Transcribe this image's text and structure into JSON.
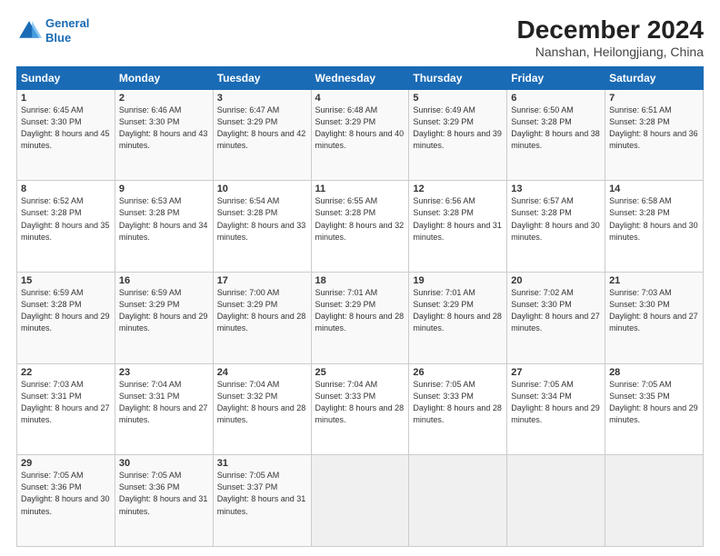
{
  "logo": {
    "line1": "General",
    "line2": "Blue"
  },
  "title": "December 2024",
  "subtitle": "Nanshan, Heilongjiang, China",
  "days_of_week": [
    "Sunday",
    "Monday",
    "Tuesday",
    "Wednesday",
    "Thursday",
    "Friday",
    "Saturday"
  ],
  "weeks": [
    [
      {
        "day": "1",
        "sunrise": "6:45 AM",
        "sunset": "3:30 PM",
        "daylight": "8 hours and 45 minutes."
      },
      {
        "day": "2",
        "sunrise": "6:46 AM",
        "sunset": "3:30 PM",
        "daylight": "8 hours and 43 minutes."
      },
      {
        "day": "3",
        "sunrise": "6:47 AM",
        "sunset": "3:29 PM",
        "daylight": "8 hours and 42 minutes."
      },
      {
        "day": "4",
        "sunrise": "6:48 AM",
        "sunset": "3:29 PM",
        "daylight": "8 hours and 40 minutes."
      },
      {
        "day": "5",
        "sunrise": "6:49 AM",
        "sunset": "3:29 PM",
        "daylight": "8 hours and 39 minutes."
      },
      {
        "day": "6",
        "sunrise": "6:50 AM",
        "sunset": "3:28 PM",
        "daylight": "8 hours and 38 minutes."
      },
      {
        "day": "7",
        "sunrise": "6:51 AM",
        "sunset": "3:28 PM",
        "daylight": "8 hours and 36 minutes."
      }
    ],
    [
      {
        "day": "8",
        "sunrise": "6:52 AM",
        "sunset": "3:28 PM",
        "daylight": "8 hours and 35 minutes."
      },
      {
        "day": "9",
        "sunrise": "6:53 AM",
        "sunset": "3:28 PM",
        "daylight": "8 hours and 34 minutes."
      },
      {
        "day": "10",
        "sunrise": "6:54 AM",
        "sunset": "3:28 PM",
        "daylight": "8 hours and 33 minutes."
      },
      {
        "day": "11",
        "sunrise": "6:55 AM",
        "sunset": "3:28 PM",
        "daylight": "8 hours and 32 minutes."
      },
      {
        "day": "12",
        "sunrise": "6:56 AM",
        "sunset": "3:28 PM",
        "daylight": "8 hours and 31 minutes."
      },
      {
        "day": "13",
        "sunrise": "6:57 AM",
        "sunset": "3:28 PM",
        "daylight": "8 hours and 30 minutes."
      },
      {
        "day": "14",
        "sunrise": "6:58 AM",
        "sunset": "3:28 PM",
        "daylight": "8 hours and 30 minutes."
      }
    ],
    [
      {
        "day": "15",
        "sunrise": "6:59 AM",
        "sunset": "3:28 PM",
        "daylight": "8 hours and 29 minutes."
      },
      {
        "day": "16",
        "sunrise": "6:59 AM",
        "sunset": "3:29 PM",
        "daylight": "8 hours and 29 minutes."
      },
      {
        "day": "17",
        "sunrise": "7:00 AM",
        "sunset": "3:29 PM",
        "daylight": "8 hours and 28 minutes."
      },
      {
        "day": "18",
        "sunrise": "7:01 AM",
        "sunset": "3:29 PM",
        "daylight": "8 hours and 28 minutes."
      },
      {
        "day": "19",
        "sunrise": "7:01 AM",
        "sunset": "3:29 PM",
        "daylight": "8 hours and 28 minutes."
      },
      {
        "day": "20",
        "sunrise": "7:02 AM",
        "sunset": "3:30 PM",
        "daylight": "8 hours and 27 minutes."
      },
      {
        "day": "21",
        "sunrise": "7:03 AM",
        "sunset": "3:30 PM",
        "daylight": "8 hours and 27 minutes."
      }
    ],
    [
      {
        "day": "22",
        "sunrise": "7:03 AM",
        "sunset": "3:31 PM",
        "daylight": "8 hours and 27 minutes."
      },
      {
        "day": "23",
        "sunrise": "7:04 AM",
        "sunset": "3:31 PM",
        "daylight": "8 hours and 27 minutes."
      },
      {
        "day": "24",
        "sunrise": "7:04 AM",
        "sunset": "3:32 PM",
        "daylight": "8 hours and 28 minutes."
      },
      {
        "day": "25",
        "sunrise": "7:04 AM",
        "sunset": "3:33 PM",
        "daylight": "8 hours and 28 minutes."
      },
      {
        "day": "26",
        "sunrise": "7:05 AM",
        "sunset": "3:33 PM",
        "daylight": "8 hours and 28 minutes."
      },
      {
        "day": "27",
        "sunrise": "7:05 AM",
        "sunset": "3:34 PM",
        "daylight": "8 hours and 29 minutes."
      },
      {
        "day": "28",
        "sunrise": "7:05 AM",
        "sunset": "3:35 PM",
        "daylight": "8 hours and 29 minutes."
      }
    ],
    [
      {
        "day": "29",
        "sunrise": "7:05 AM",
        "sunset": "3:36 PM",
        "daylight": "8 hours and 30 minutes."
      },
      {
        "day": "30",
        "sunrise": "7:05 AM",
        "sunset": "3:36 PM",
        "daylight": "8 hours and 31 minutes."
      },
      {
        "day": "31",
        "sunrise": "7:05 AM",
        "sunset": "3:37 PM",
        "daylight": "8 hours and 31 minutes."
      },
      null,
      null,
      null,
      null
    ]
  ]
}
